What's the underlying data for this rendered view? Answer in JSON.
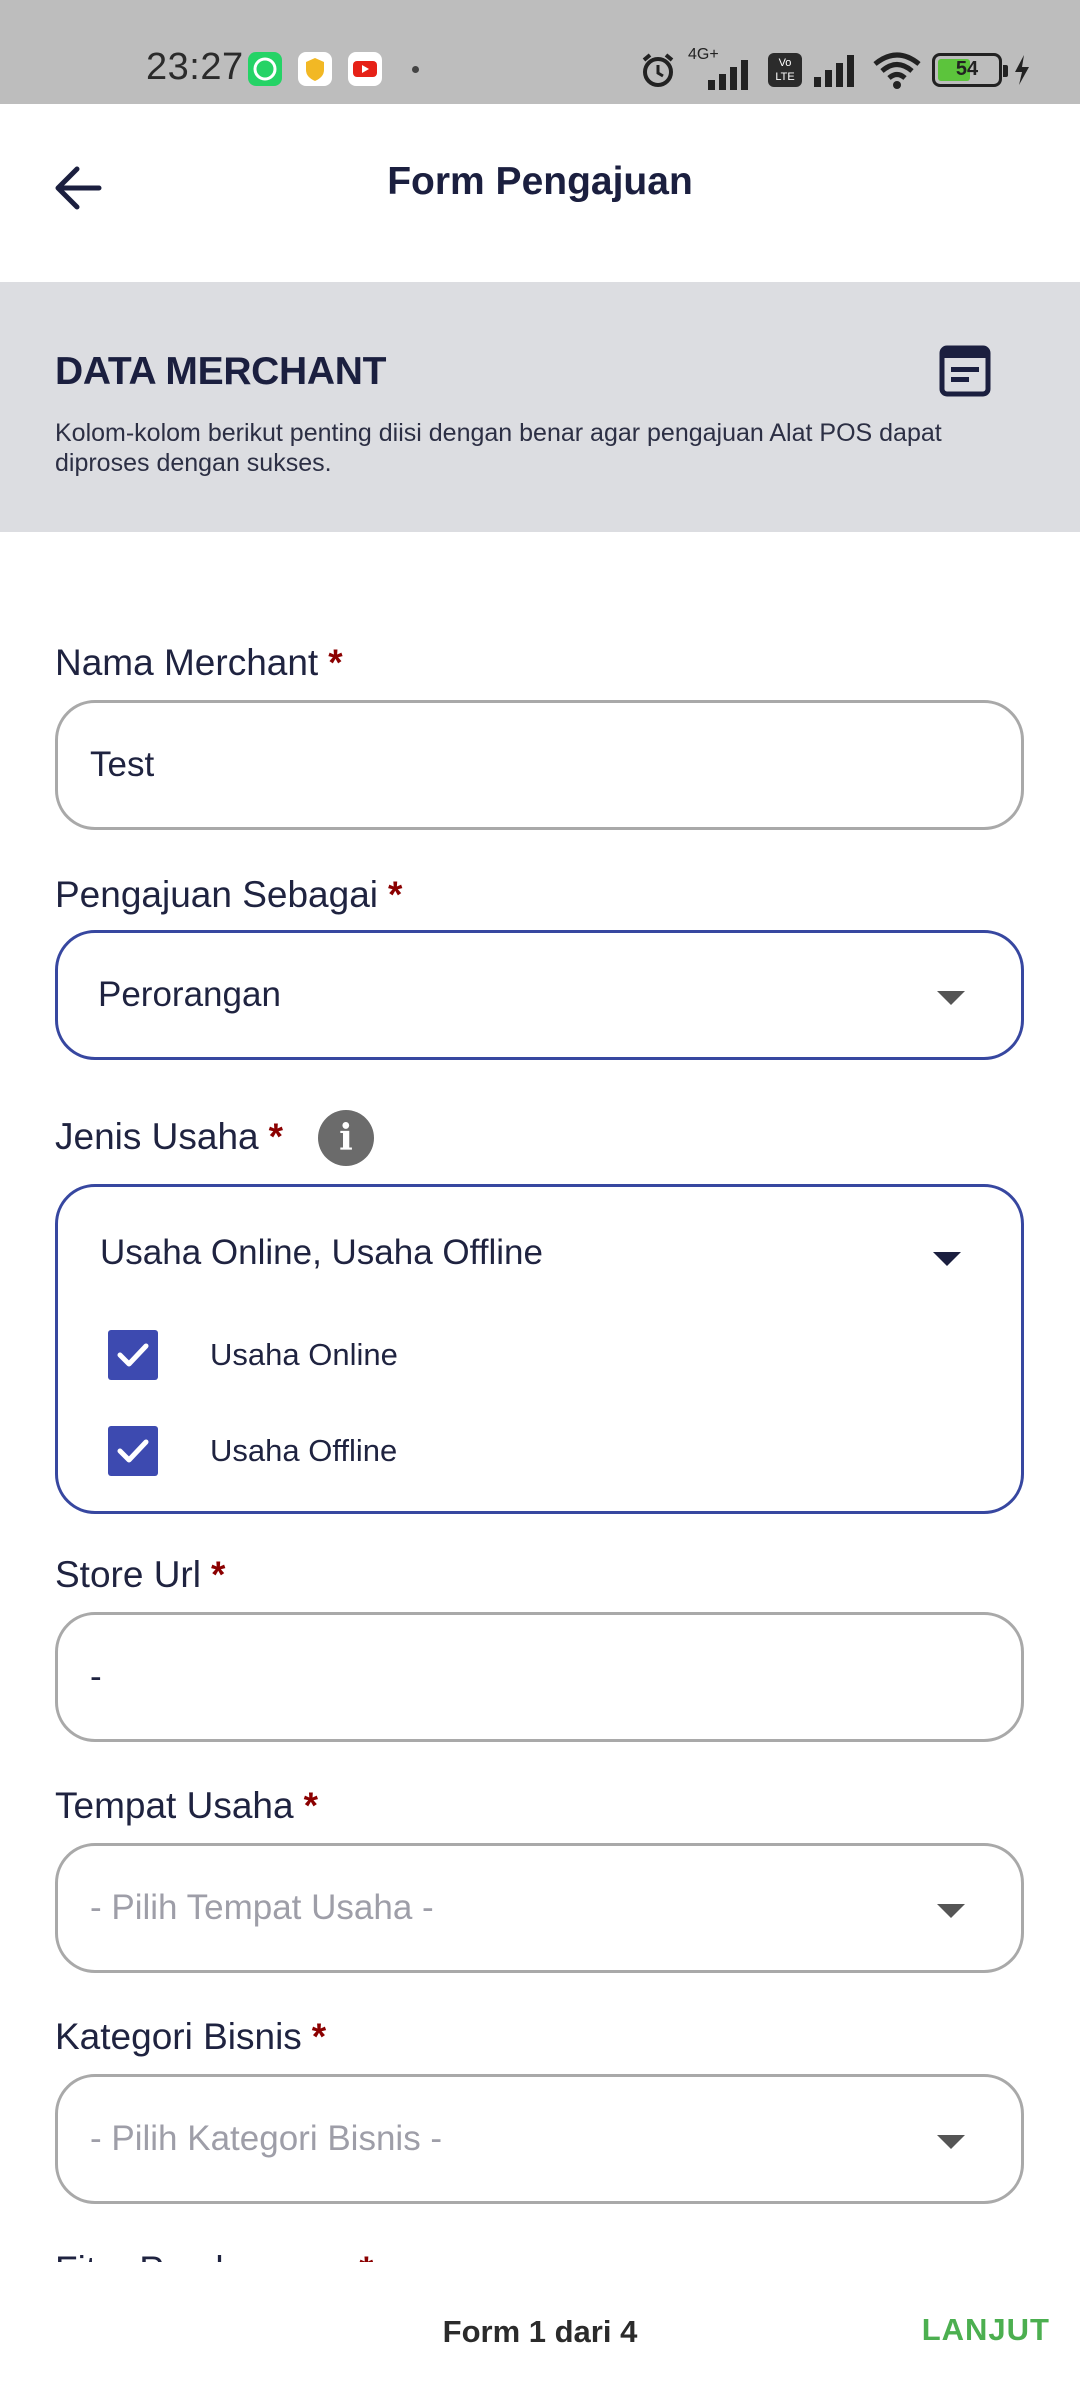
{
  "status_bar": {
    "time": "23:27",
    "network": "4G+",
    "volte": "Vo LTE",
    "battery": "54",
    "icons": [
      "whatsapp-icon",
      "shield-app-icon",
      "youtube-icon",
      "alarm-icon",
      "signal-icon",
      "wifi-icon",
      "battery-icon",
      "charging-icon"
    ]
  },
  "app_bar": {
    "title": "Form Pengajuan"
  },
  "info_panel": {
    "title": "DATA MERCHANT",
    "description": "Kolom-kolom berikut penting diisi dengan benar agar pengajuan Alat POS dapat diproses dengan sukses."
  },
  "form": {
    "required_marker": "*",
    "nama_merchant": {
      "label": "Nama Merchant",
      "value": "Test"
    },
    "pengajuan_sebagai": {
      "label": "Pengajuan Sebagai",
      "value": "Perorangan"
    },
    "jenis_usaha": {
      "label": "Jenis Usaha",
      "info": "i",
      "value": "Usaha Online, Usaha Offline",
      "options": [
        {
          "label": "Usaha Online",
          "checked": true
        },
        {
          "label": "Usaha Offline",
          "checked": true
        }
      ]
    },
    "store_url": {
      "label": "Store Url",
      "value": "-"
    },
    "tempat_usaha": {
      "label": "Tempat Usaha",
      "placeholder": "- Pilih Tempat Usaha -"
    },
    "kategori_bisnis": {
      "label": "Kategori Bisnis",
      "placeholder": "- Pilih Kategori Bisnis -"
    },
    "fitur_pembayaran": {
      "label": "Fitur Pembayaran"
    }
  },
  "footer": {
    "page_indicator": "Form 1 dari 4",
    "next_label": "LANJUT"
  },
  "colors": {
    "accent": "#3747a0",
    "required": "#8b0000",
    "next": "#4caf50",
    "checkbox": "#3d4ab0"
  }
}
